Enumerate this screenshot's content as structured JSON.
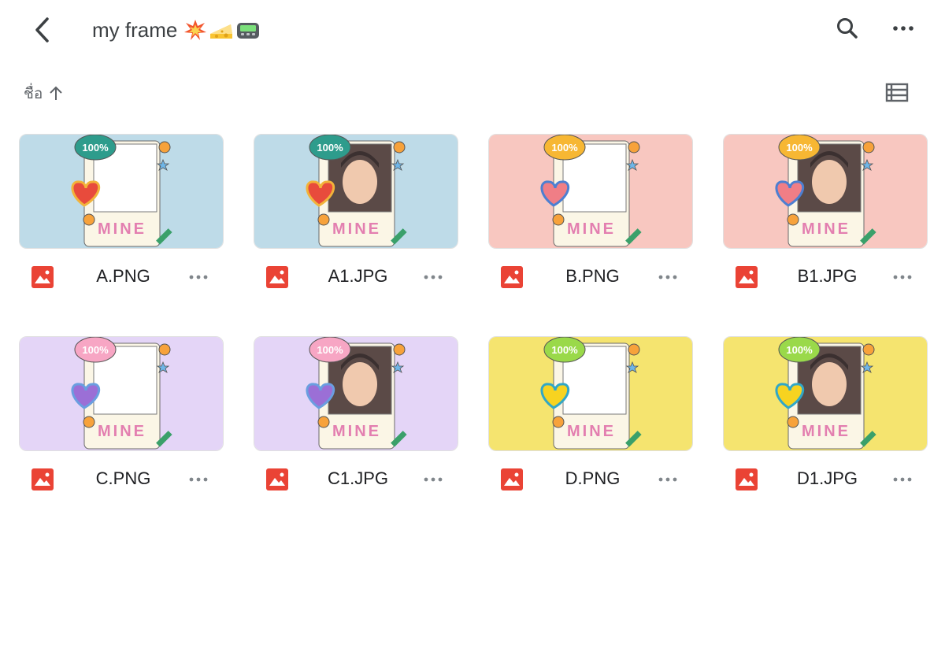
{
  "header": {
    "title": "my frame",
    "emojis": [
      "collision-emoji",
      "cheese-emoji",
      "pager-emoji"
    ],
    "icons": {
      "back": "back-arrow-icon",
      "search": "search-icon",
      "more": "more-horizontal-icon"
    }
  },
  "sort": {
    "label": "ชื่อ",
    "direction_icon": "arrow-up-icon"
  },
  "view_toggle_icon": "list-view-icon",
  "colors": {
    "blue_bg": "#bedbe8",
    "pink_bg": "#f8c7c0",
    "purple_bg": "#e4d5f7",
    "yellow_bg": "#f5e46f",
    "file_icon_red": "#ea4335"
  },
  "files": [
    {
      "name": "A.PNG",
      "bg": "blue",
      "has_photo": false
    },
    {
      "name": "A1.JPG",
      "bg": "blue",
      "has_photo": true
    },
    {
      "name": "B.PNG",
      "bg": "pink",
      "has_photo": false
    },
    {
      "name": "B1.JPG",
      "bg": "pink",
      "has_photo": true
    },
    {
      "name": "C.PNG",
      "bg": "purple",
      "has_photo": false
    },
    {
      "name": "C1.JPG",
      "bg": "purple",
      "has_photo": true
    },
    {
      "name": "D.PNG",
      "bg": "yellow",
      "has_photo": false
    },
    {
      "name": "D1.JPG",
      "bg": "yellow",
      "has_photo": true
    }
  ],
  "frame_art": {
    "badge_text": "100%",
    "frame_text": "MINE"
  }
}
